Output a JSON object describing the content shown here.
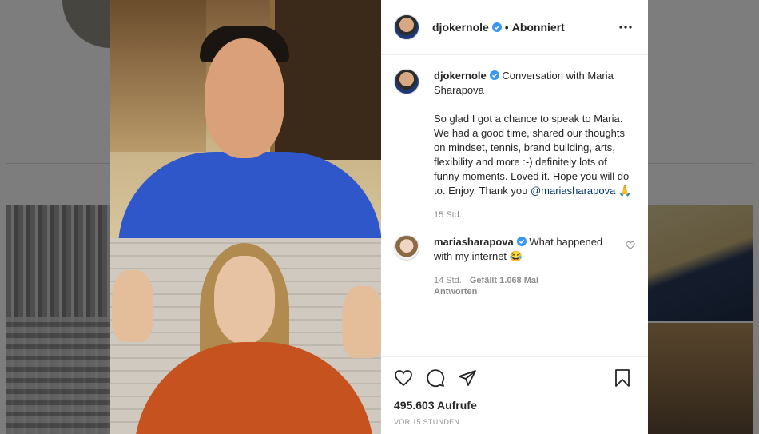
{
  "post": {
    "username": "djokernole",
    "follow_status": "Abonniert",
    "caption_title": "Conversation with Maria Sharapova",
    "caption_body": "So glad I got a chance to speak to Maria. We had a good time, shared our thoughts on mindset, tennis, brand building, arts, flexibility and more :-) definitely lots of funny moments. Loved it. Hope you will do to. Enjoy. Thank you ",
    "caption_mention": "@mariasharapova",
    "caption_emoji": "🙏",
    "caption_age": "15 Std.",
    "views": "495.603 Aufrufe",
    "posted": "VOR 15 STUNDEN"
  },
  "comment": {
    "username": "mariasharapova",
    "text": "What happened with my internet",
    "emoji": "😂",
    "age": "14 Std.",
    "likes": "Gefällt 1.068 Mal",
    "reply": "Antworten"
  },
  "icons": {
    "verified": "verified-badge",
    "more": "more-options",
    "like": "heart",
    "comment": "comment-bubble",
    "share": "paper-plane",
    "save": "bookmark"
  },
  "colors": {
    "verified_blue": "#3897f0",
    "mention": "#00376b",
    "muted": "#8e8e8e"
  }
}
